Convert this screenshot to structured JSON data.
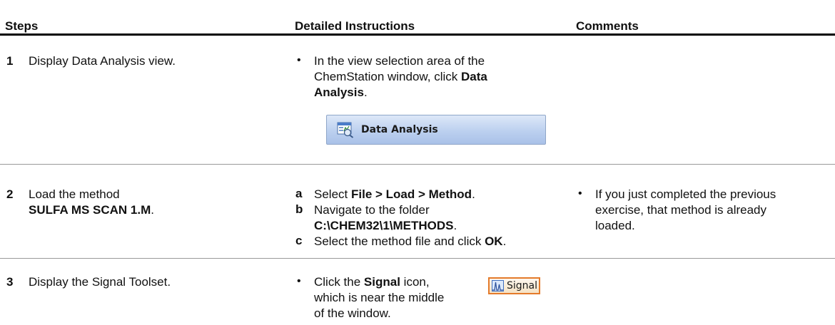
{
  "table": {
    "headers": {
      "steps": "Steps",
      "detailed": "Detailed Instructions",
      "comments": "Comments"
    },
    "rows": [
      {
        "number": "1",
        "step": "Display Data Analysis view.",
        "instruction": {
          "bullet": "•",
          "line1": "In the view selection area of the",
          "line2": "ChemStation window, click ",
          "bold_a": "Data",
          "bold_b": "Analysis",
          "period": "."
        },
        "button": {
          "label": "Data Analysis",
          "icon": "data-analysis-icon"
        }
      },
      {
        "number": "2",
        "step": "Load the method",
        "step_bold": "SULFA MS SCAN 1.M",
        "step_period": ".",
        "instructions": [
          {
            "letter": "a",
            "prefix": "Select ",
            "bold": "File > Load > Method",
            "suffix": "."
          },
          {
            "letter": "b",
            "text": "Navigate to the folder",
            "path": "C:\\CHEM32\\1\\METHODS",
            "suffix": "."
          },
          {
            "letter": "c",
            "prefix": "Select the method file and click ",
            "bold": "OK",
            "suffix": "."
          }
        ],
        "comment": {
          "bullet": "•",
          "line1": "If you just completed the previous",
          "line2": "exercise, that method is already",
          "line3": "loaded."
        }
      },
      {
        "number": "3",
        "step": "Display the Signal Toolset.",
        "instruction": {
          "bullet": "•",
          "line1_prefix": "Click the ",
          "line1_bold": "Signal",
          "line1_suffix": " icon,",
          "line2": "which is near the middle",
          "line3": "of the window."
        },
        "button": {
          "label": "Signal",
          "icon": "signal-icon"
        }
      }
    ]
  },
  "colors": {
    "data_analysis_button": "#bcd0ef",
    "signal_button_border": "#e47a2a",
    "rule": "#9a9a9a"
  }
}
